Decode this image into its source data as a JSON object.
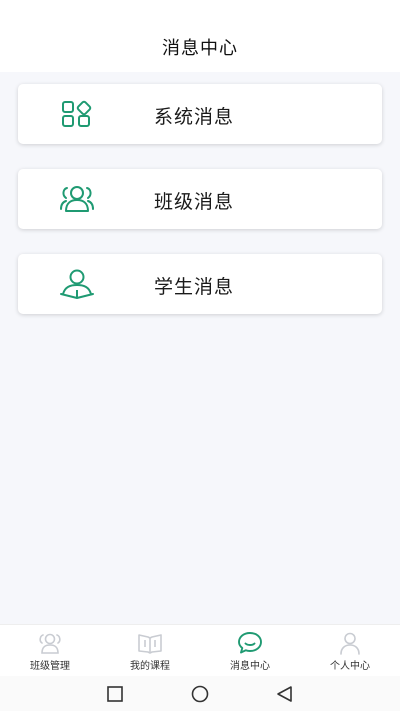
{
  "header": {
    "title": "消息中心"
  },
  "cards": [
    {
      "label": "系统消息",
      "icon": "grid-apps-icon"
    },
    {
      "label": "班级消息",
      "icon": "group-users-icon"
    },
    {
      "label": "学生消息",
      "icon": "student-reading-icon"
    }
  ],
  "tabbar": {
    "items": [
      {
        "label": "班级管理",
        "icon": "class-users-icon",
        "active": false
      },
      {
        "label": "我的课程",
        "icon": "book-icon",
        "active": false
      },
      {
        "label": "消息中心",
        "icon": "chat-bubble-icon",
        "active": true
      },
      {
        "label": "个人中心",
        "icon": "person-icon",
        "active": false
      }
    ]
  },
  "colors": {
    "accent": "#1f9a72",
    "inactive_icon": "#c9ccd2",
    "page_bg": "#f6f7fb"
  },
  "system_nav": {
    "buttons": [
      "square-recent-icon",
      "circle-home-icon",
      "triangle-back-icon"
    ]
  }
}
